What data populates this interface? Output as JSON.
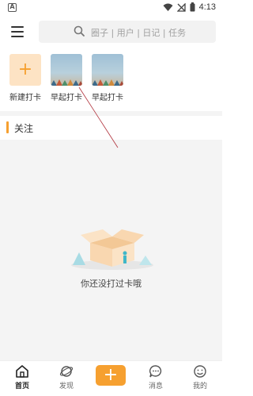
{
  "status_bar": {
    "left_icon_glyph": "A",
    "time": "4:13",
    "icons": [
      "wifi-icon",
      "signal-off-icon",
      "battery-icon"
    ]
  },
  "header": {
    "menu_icon": "menu-icon",
    "search_placeholder": "圈子 | 用户 | 日记 | 任务"
  },
  "checkins": {
    "items": [
      {
        "label": "新建打卡",
        "icon": "plus-icon"
      },
      {
        "label": "早起打卡"
      },
      {
        "label": "早起打卡"
      }
    ]
  },
  "section": {
    "title": "关注"
  },
  "feed": {
    "empty_text": "你还没打过卡哦"
  },
  "tabbar": {
    "tabs": [
      {
        "label": "首页",
        "icon": "home-icon",
        "active": true
      },
      {
        "label": "发现",
        "icon": "planet-icon",
        "active": false
      },
      {
        "label": "",
        "icon": "plus-icon",
        "active": false
      },
      {
        "label": "消息",
        "icon": "chat-icon",
        "active": false
      },
      {
        "label": "我的",
        "icon": "smile-icon",
        "active": false
      }
    ],
    "publish_glyph": "+"
  },
  "colors": {
    "accent": "#f6a030",
    "accent_light": "#fde3c4",
    "background_gray": "#f4f4f4"
  }
}
